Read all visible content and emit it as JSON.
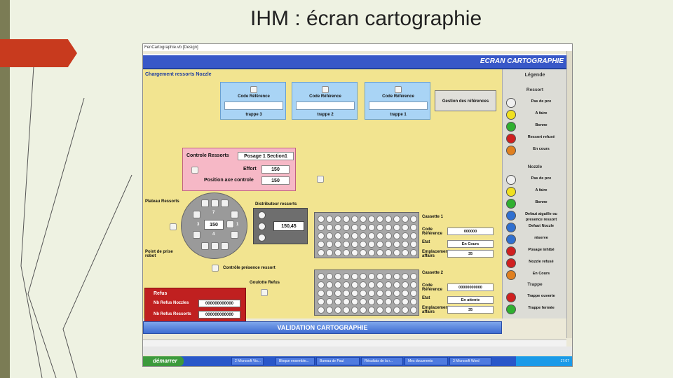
{
  "slide": {
    "title": "IHM : écran cartographie"
  },
  "window": {
    "title": "FenCartographie.vb [Design]",
    "header_title": "ECRAN CARTOGRAPHIE",
    "section_title": "Chargement ressorts Nozzle",
    "traps": [
      {
        "code_label": "Code Référence",
        "label": "trappe 3"
      },
      {
        "code_label": "Code Référence",
        "label": "trappe 2"
      },
      {
        "code_label": "Code Référence",
        "label": "trappe 1"
      }
    ],
    "gestion_button": "Gestion des références",
    "controle": {
      "title": "Controle Ressorts",
      "posage": "Posage 1 Section1",
      "effort_label": "Effort",
      "effort_value": "150",
      "position_label": "Position axe controle",
      "position_value": "150"
    },
    "plateau": {
      "title": "Plateau Ressorts",
      "n7": "7",
      "n3": "3",
      "value": "150",
      "n1": "1",
      "n4": "4",
      "point_label": "Point de prise robot"
    },
    "distributeur": {
      "title": "Distributeur ressorts",
      "value": "150,45"
    },
    "controle_presence": "Contrôle présence ressort",
    "goulotte": "Goulotte Refus",
    "cassettes": [
      {
        "title": "Cassette 1",
        "code_label": "Code Référence",
        "code_value": "000000",
        "etat_label": "Etat",
        "etat_value": "En Cours",
        "empl_label": "Emplacement affairs",
        "empl_value": "35"
      },
      {
        "title": "Cassette 2",
        "code_label": "Code Référence",
        "code_value": "00000000000",
        "etat_label": "Etat",
        "etat_value": "En attente",
        "empl_label": "Emplacement affairs",
        "empl_value": "35"
      }
    ],
    "refus": {
      "title": "Refus",
      "nozzles_label": "Nb Refus Nozzles",
      "nozzles_value": "000000000000",
      "ressorts_label": "Nb Refus Ressorts",
      "ressorts_value": "000000000000"
    },
    "validation_button": "VALIDATION CARTOGRAPHIE",
    "legend": {
      "title": "Légende",
      "ressort_header": "Ressort",
      "nozzle_header": "Nozzle",
      "trappe_header": "Trappe",
      "ressort_items": [
        {
          "label": "Pas de pce",
          "color": "#f0f0f0"
        },
        {
          "label": "A faire",
          "color": "#f0e020"
        },
        {
          "label": "Bonne",
          "color": "#30b030"
        },
        {
          "label": "Ressort refusé",
          "color": "#d02020"
        },
        {
          "label": "En cours",
          "color": "#e08020"
        }
      ],
      "nozzle_items": [
        {
          "label": "Pas de pce",
          "color": "#f0f0f0"
        },
        {
          "label": "A faire",
          "color": "#f0e020"
        },
        {
          "label": "Bonne",
          "color": "#30b030"
        },
        {
          "label": "Defaut aiguille ou presence ressort",
          "color": "#3070d0"
        },
        {
          "label": "Defaut Nozzle",
          "color": "#3070d0"
        },
        {
          "label": "réserve",
          "color": "#3070d0"
        },
        {
          "label": "Posage inhibé",
          "color": "#d02020"
        },
        {
          "label": "Nozzle refusé",
          "color": "#d02020"
        },
        {
          "label": "En Cours",
          "color": "#e08020"
        }
      ],
      "trappe_items": [
        {
          "label": "Trappe ouverte",
          "color": "#d02020"
        },
        {
          "label": "Trappe fermée",
          "color": "#30b030"
        }
      ]
    }
  },
  "taskbar": {
    "start_label": "démarrer",
    "tasks": [
      "2 Microsoft Vis...",
      "Bloque ensemble...",
      "Bureau de Paul",
      "Résultats de la r...",
      "Mes documents",
      "3 Microsoft Word"
    ],
    "clock": "17:07"
  }
}
